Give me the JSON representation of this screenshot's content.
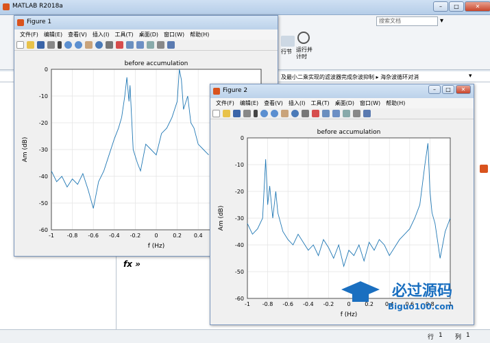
{
  "app": {
    "title": "MATLAB R2018a",
    "search_placeholder": "搜索文档",
    "toolstrip_labels": [
      "行节",
      "运行并\n计时"
    ],
    "path_text": "及最小二乘实现的滤波器完成杂波抑制 ▸ 海杂波循环对消",
    "fx_label": "fx »",
    "status": {
      "row_label": "行",
      "row": "1",
      "col_label": "列",
      "col": "1"
    }
  },
  "menus": [
    "文件(F)",
    "编辑(E)",
    "查看(V)",
    "插入(I)",
    "工具(T)",
    "桌面(D)",
    "窗口(W)",
    "帮助(H)"
  ],
  "watermark": {
    "cn": "必过源码",
    "en": "Biguo100.com"
  },
  "figures": [
    {
      "window_title": "Figure 1",
      "plot_title": "before accumulation",
      "xlabel": "f (Hz)",
      "ylabel": "Am (dB)",
      "xlim": [
        -1,
        1
      ],
      "ylim": [
        -60,
        0
      ],
      "xticks": [
        "-1",
        "-0.8",
        "-0.6",
        "-0.4",
        "-0.2",
        "0",
        "0.2",
        "0.4"
      ],
      "yticks": [
        "0",
        "-10",
        "-20",
        "-30",
        "-40",
        "-50",
        "-60"
      ],
      "grid": true
    },
    {
      "window_title": "Figure 2",
      "plot_title": "before accumulation",
      "xlabel": "f (Hz)",
      "ylabel": "Am (dB)",
      "xlim": [
        -1,
        1
      ],
      "ylim": [
        -60,
        0
      ],
      "xticks": [
        "-1",
        "-0.8",
        "-0.6",
        "-0.4",
        "-0.2",
        "0",
        "0.2",
        "0.4",
        "0.6",
        "0.8",
        "1"
      ],
      "yticks": [
        "0",
        "-10",
        "-20",
        "-30",
        "-40",
        "-50",
        "-60"
      ],
      "grid": true
    }
  ],
  "chart_data": [
    {
      "type": "line",
      "title": "before accumulation",
      "xlabel": "f (Hz)",
      "ylabel": "Am (dB)",
      "xlim": [
        -1,
        1
      ],
      "ylim": [
        -60,
        0
      ],
      "grid": true,
      "x": [
        -1,
        -0.95,
        -0.9,
        -0.85,
        -0.8,
        -0.75,
        -0.7,
        -0.65,
        -0.6,
        -0.55,
        -0.5,
        -0.45,
        -0.4,
        -0.36,
        -0.33,
        -0.3,
        -0.28,
        -0.26,
        -0.25,
        -0.22,
        -0.18,
        -0.15,
        -0.1,
        -0.05,
        0,
        0.05,
        0.1,
        0.15,
        0.2,
        0.22,
        0.24,
        0.26,
        0.3,
        0.33,
        0.36,
        0.4,
        0.45,
        0.5
      ],
      "y": [
        -38,
        -42,
        -40,
        -44,
        -41,
        -43,
        -39,
        -45,
        -52,
        -42,
        -38,
        -32,
        -26,
        -22,
        -18,
        -10,
        -3,
        -12,
        -6,
        -30,
        -35,
        -38,
        -28,
        -30,
        -32,
        -24,
        -22,
        -18,
        -12,
        0,
        -4,
        -15,
        -10,
        -20,
        -22,
        -28,
        -30,
        -32
      ]
    },
    {
      "type": "line",
      "title": "before accumulation",
      "xlabel": "f (Hz)",
      "ylabel": "Am (dB)",
      "xlim": [
        -1,
        1
      ],
      "ylim": [
        -60,
        0
      ],
      "grid": true,
      "x": [
        -1,
        -0.95,
        -0.9,
        -0.85,
        -0.82,
        -0.8,
        -0.78,
        -0.75,
        -0.72,
        -0.7,
        -0.65,
        -0.6,
        -0.55,
        -0.5,
        -0.45,
        -0.4,
        -0.35,
        -0.3,
        -0.25,
        -0.2,
        -0.15,
        -0.1,
        -0.05,
        0,
        0.05,
        0.1,
        0.15,
        0.2,
        0.25,
        0.3,
        0.35,
        0.4,
        0.45,
        0.5,
        0.55,
        0.6,
        0.65,
        0.7,
        0.75,
        0.78,
        0.8,
        0.82,
        0.85,
        0.9,
        0.95,
        1
      ],
      "y": [
        -32,
        -36,
        -34,
        -30,
        -8,
        -25,
        -18,
        -30,
        -20,
        -28,
        -35,
        -38,
        -40,
        -36,
        -39,
        -42,
        -40,
        -44,
        -38,
        -41,
        -45,
        -40,
        -48,
        -42,
        -44,
        -40,
        -46,
        -39,
        -42,
        -38,
        -40,
        -44,
        -41,
        -38,
        -36,
        -34,
        -30,
        -25,
        -10,
        -2,
        -20,
        -28,
        -32,
        -45,
        -35,
        -30
      ]
    }
  ]
}
